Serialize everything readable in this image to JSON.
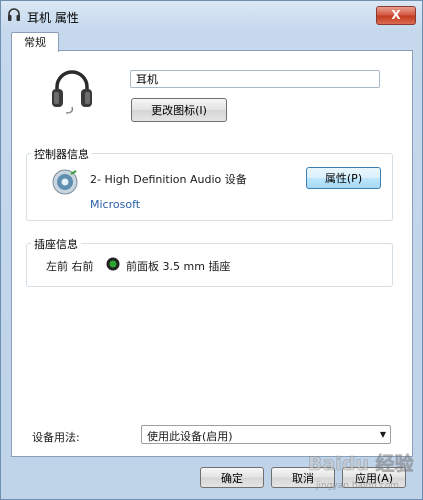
{
  "window": {
    "title": "耳机 属性",
    "close_label": "X"
  },
  "tabs": [
    {
      "label": "常规",
      "active": true
    }
  ],
  "device": {
    "name": "耳机",
    "change_icon_label": "更改图标(I)"
  },
  "controller": {
    "group_label": "控制器信息",
    "name": "2- High Definition Audio 设备",
    "vendor": "Microsoft",
    "properties_label": "属性(P)"
  },
  "jack": {
    "group_label": "插座信息",
    "location": "左前 右前",
    "jack_color": "#2fa52f",
    "description": "前面板 3.5 mm 插座"
  },
  "usage": {
    "label": "设备用法:",
    "selected": "使用此设备(启用)"
  },
  "footer": {
    "ok_label": "确定",
    "cancel_label": "取消",
    "apply_label": "应用(A)"
  },
  "watermark": {
    "text": "Baidu 经验",
    "sub": "jingyan.baidu.com"
  }
}
